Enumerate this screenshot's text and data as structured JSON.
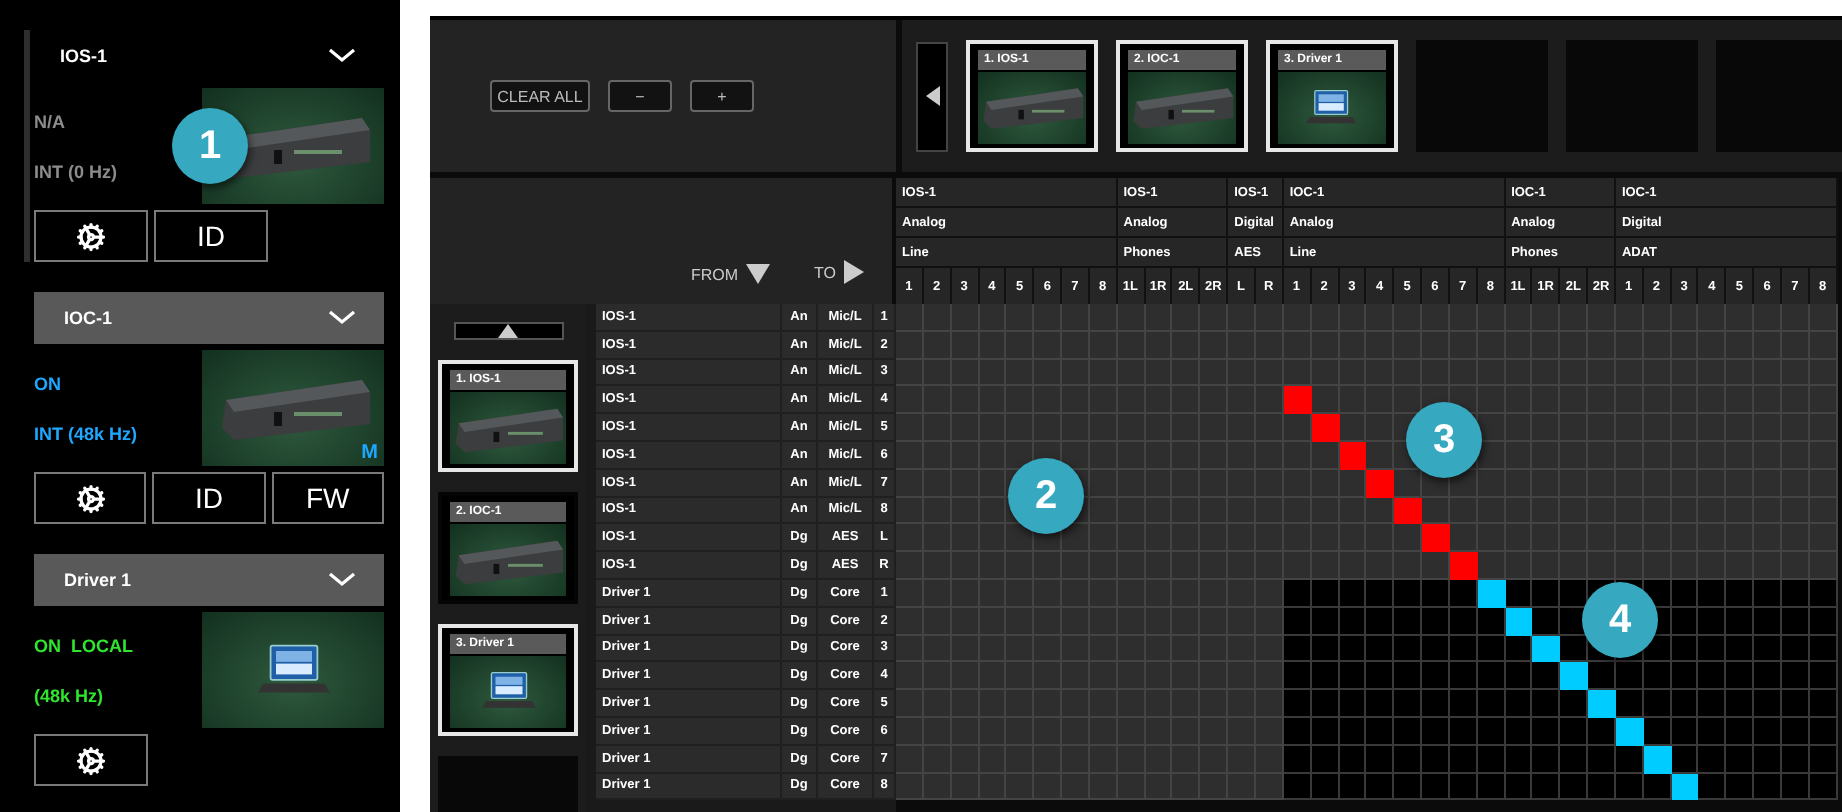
{
  "devices": [
    {
      "name": "IOS-1",
      "selected": true,
      "color": "#8c8c8c",
      "status": "N/A",
      "clock": "INT (0 Hz)",
      "kind": "hardware",
      "buttons": [
        {
          "kind": "gear"
        },
        {
          "kind": "text",
          "label": "ID"
        }
      ]
    },
    {
      "name": "IOC-1",
      "selected": false,
      "color": "#1ea7ff",
      "status": "ON",
      "clock": "INT (48k Hz)",
      "kind": "hardware",
      "badge": "M",
      "buttons": [
        {
          "kind": "gear"
        },
        {
          "kind": "text",
          "label": "ID"
        },
        {
          "kind": "text",
          "label": "FW"
        }
      ]
    },
    {
      "name": "Driver 1",
      "selected": false,
      "color": "#2ee62e",
      "status": "ON  LOCAL",
      "clock": "(48k Hz)",
      "kind": "driver",
      "buttons": [
        {
          "kind": "gear"
        }
      ]
    }
  ],
  "toolbar": {
    "buttons": [
      "CLEAR ALL",
      "−",
      "+"
    ]
  },
  "top_strip": [
    {
      "kind": "hardware",
      "label": "1. IOS-1",
      "selected": true
    },
    {
      "kind": "hardware",
      "label": "2. IOC-1",
      "selected": true
    },
    {
      "kind": "driver",
      "label": "3. Driver 1",
      "selected": true
    },
    {
      "kind": "empty"
    },
    {
      "kind": "empty"
    },
    {
      "kind": "empty"
    }
  ],
  "side_strip": [
    {
      "kind": "hardware",
      "label": "1. IOS-1",
      "selected": true
    },
    {
      "kind": "hardware",
      "label": "2. IOC-1",
      "selected": false
    },
    {
      "kind": "driver",
      "label": "3. Driver 1",
      "selected": true
    },
    {
      "kind": "empty"
    }
  ],
  "corner": {
    "from": "FROM",
    "to": "TO"
  },
  "column_groups": [
    {
      "device": "IOS-1",
      "type": "Analog",
      "sub": "Line",
      "dark": false,
      "channels": [
        "1",
        "2",
        "3",
        "4",
        "5",
        "6",
        "7",
        "8"
      ]
    },
    {
      "device": "IOS-1",
      "type": "Analog",
      "sub": "Phones",
      "dark": false,
      "channels": [
        "1L",
        "1R",
        "2L",
        "2R"
      ]
    },
    {
      "device": "IOS-1",
      "type": "Digital",
      "sub": "AES",
      "dark": false,
      "channels": [
        "L",
        "R"
      ]
    },
    {
      "device": "IOC-1",
      "type": "Analog",
      "sub": "Line",
      "dark": true,
      "channels": [
        "1",
        "2",
        "3",
        "4",
        "5",
        "6",
        "7",
        "8"
      ]
    },
    {
      "device": "IOC-1",
      "type": "Analog",
      "sub": "Phones",
      "dark": true,
      "channels": [
        "1L",
        "1R",
        "2L",
        "2R"
      ]
    },
    {
      "device": "IOC-1",
      "type": "Digital",
      "sub": "ADAT",
      "dark": true,
      "channels": [
        "1",
        "2",
        "3",
        "4",
        "5",
        "6",
        "7",
        "8"
      ]
    }
  ],
  "rows": [
    {
      "device": "IOS-1",
      "type": "An",
      "sub": "Mic/L",
      "channel": "1",
      "dark": false,
      "cells": [
        false,
        false,
        false,
        false,
        false,
        false,
        false,
        false,
        false,
        false,
        false,
        false,
        false,
        false,
        false,
        false,
        false,
        false,
        false,
        false,
        false,
        false,
        false,
        false,
        false,
        false,
        false,
        false,
        false,
        false,
        false,
        false,
        false,
        false
      ]
    },
    {
      "device": "IOS-1",
      "type": "An",
      "sub": "Mic/L",
      "channel": "2",
      "dark": false,
      "cells": [
        false,
        false,
        false,
        false,
        false,
        false,
        false,
        false,
        false,
        false,
        false,
        false,
        false,
        false,
        false,
        false,
        false,
        false,
        false,
        false,
        false,
        false,
        false,
        false,
        false,
        false,
        false,
        false,
        false,
        false,
        false,
        false,
        false,
        false
      ]
    },
    {
      "device": "IOS-1",
      "type": "An",
      "sub": "Mic/L",
      "channel": "3",
      "dark": false,
      "cells": [
        false,
        false,
        false,
        false,
        false,
        false,
        false,
        false,
        false,
        false,
        false,
        false,
        false,
        false,
        false,
        false,
        false,
        false,
        false,
        false,
        false,
        false,
        false,
        false,
        false,
        false,
        false,
        false,
        false,
        false,
        false,
        false,
        false,
        false
      ]
    },
    {
      "device": "IOS-1",
      "type": "An",
      "sub": "Mic/L",
      "channel": "4",
      "dark": false,
      "color": "#ff0000",
      "cells": [
        false,
        false,
        false,
        false,
        false,
        false,
        false,
        false,
        false,
        false,
        false,
        false,
        false,
        false,
        true,
        false,
        false,
        false,
        false,
        false,
        false,
        false,
        false,
        false,
        false,
        false,
        false,
        false,
        false,
        false,
        false,
        false,
        false,
        false
      ]
    },
    {
      "device": "IOS-1",
      "type": "An",
      "sub": "Mic/L",
      "channel": "5",
      "dark": false,
      "color": "#ff0000",
      "cells": [
        false,
        false,
        false,
        false,
        false,
        false,
        false,
        false,
        false,
        false,
        false,
        false,
        false,
        false,
        false,
        true,
        false,
        false,
        false,
        false,
        false,
        false,
        false,
        false,
        false,
        false,
        false,
        false,
        false,
        false,
        false,
        false,
        false,
        false
      ]
    },
    {
      "device": "IOS-1",
      "type": "An",
      "sub": "Mic/L",
      "channel": "6",
      "dark": false,
      "color": "#ff0000",
      "cells": [
        false,
        false,
        false,
        false,
        false,
        false,
        false,
        false,
        false,
        false,
        false,
        false,
        false,
        false,
        false,
        false,
        true,
        false,
        false,
        false,
        false,
        false,
        false,
        false,
        false,
        false,
        false,
        false,
        false,
        false,
        false,
        false,
        false,
        false
      ]
    },
    {
      "device": "IOS-1",
      "type": "An",
      "sub": "Mic/L",
      "channel": "7",
      "dark": false,
      "color": "#ff0000",
      "cells": [
        false,
        false,
        false,
        false,
        false,
        false,
        false,
        false,
        false,
        false,
        false,
        false,
        false,
        false,
        false,
        false,
        false,
        true,
        false,
        false,
        false,
        false,
        false,
        false,
        false,
        false,
        false,
        false,
        false,
        false,
        false,
        false,
        false,
        false
      ]
    },
    {
      "device": "IOS-1",
      "type": "An",
      "sub": "Mic/L",
      "channel": "8",
      "dark": false,
      "color": "#ff0000",
      "cells": [
        false,
        false,
        false,
        false,
        false,
        false,
        false,
        false,
        false,
        false,
        false,
        false,
        false,
        false,
        false,
        false,
        false,
        false,
        true,
        false,
        false,
        false,
        false,
        false,
        false,
        false,
        false,
        false,
        false,
        false,
        false,
        false,
        false,
        false
      ]
    },
    {
      "device": "IOS-1",
      "type": "Dg",
      "sub": "AES",
      "channel": "L",
      "dark": false,
      "color": "#ff0000",
      "cells": [
        false,
        false,
        false,
        false,
        false,
        false,
        false,
        false,
        false,
        false,
        false,
        false,
        false,
        false,
        false,
        false,
        false,
        false,
        false,
        true,
        false,
        false,
        false,
        false,
        false,
        false,
        false,
        false,
        false,
        false,
        false,
        false,
        false,
        false
      ]
    },
    {
      "device": "IOS-1",
      "type": "Dg",
      "sub": "AES",
      "channel": "R",
      "dark": false,
      "color": "#ff0000",
      "cells": [
        false,
        false,
        false,
        false,
        false,
        false,
        false,
        false,
        false,
        false,
        false,
        false,
        false,
        false,
        false,
        false,
        false,
        false,
        false,
        false,
        true,
        false,
        false,
        false,
        false,
        false,
        false,
        false,
        false,
        false,
        false,
        false,
        false,
        false
      ]
    },
    {
      "device": "Driver 1",
      "type": "Dg",
      "sub": "Core",
      "channel": "1",
      "dark": true,
      "color": "#00ccff",
      "cells": [
        false,
        false,
        false,
        false,
        false,
        false,
        false,
        false,
        false,
        false,
        false,
        false,
        false,
        false,
        false,
        false,
        false,
        false,
        false,
        false,
        false,
        true,
        false,
        false,
        false,
        false,
        false,
        false,
        false,
        false,
        false,
        false,
        false,
        false
      ]
    },
    {
      "device": "Driver 1",
      "type": "Dg",
      "sub": "Core",
      "channel": "2",
      "dark": true,
      "color": "#00ccff",
      "cells": [
        false,
        false,
        false,
        false,
        false,
        false,
        false,
        false,
        false,
        false,
        false,
        false,
        false,
        false,
        false,
        false,
        false,
        false,
        false,
        false,
        false,
        false,
        true,
        false,
        false,
        false,
        false,
        false,
        false,
        false,
        false,
        false,
        false,
        false
      ]
    },
    {
      "device": "Driver 1",
      "type": "Dg",
      "sub": "Core",
      "channel": "3",
      "dark": true,
      "color": "#00ccff",
      "cells": [
        false,
        false,
        false,
        false,
        false,
        false,
        false,
        false,
        false,
        false,
        false,
        false,
        false,
        false,
        false,
        false,
        false,
        false,
        false,
        false,
        false,
        false,
        false,
        true,
        false,
        false,
        false,
        false,
        false,
        false,
        false,
        false,
        false,
        false
      ]
    },
    {
      "device": "Driver 1",
      "type": "Dg",
      "sub": "Core",
      "channel": "4",
      "dark": true,
      "color": "#00ccff",
      "cells": [
        false,
        false,
        false,
        false,
        false,
        false,
        false,
        false,
        false,
        false,
        false,
        false,
        false,
        false,
        false,
        false,
        false,
        false,
        false,
        false,
        false,
        false,
        false,
        false,
        true,
        false,
        false,
        false,
        false,
        false,
        false,
        false,
        false,
        false
      ]
    },
    {
      "device": "Driver 1",
      "type": "Dg",
      "sub": "Core",
      "channel": "5",
      "dark": true,
      "color": "#00ccff",
      "cells": [
        false,
        false,
        false,
        false,
        false,
        false,
        false,
        false,
        false,
        false,
        false,
        false,
        false,
        false,
        false,
        false,
        false,
        false,
        false,
        false,
        false,
        false,
        false,
        false,
        false,
        true,
        false,
        false,
        false,
        false,
        false,
        false,
        false,
        false
      ]
    },
    {
      "device": "Driver 1",
      "type": "Dg",
      "sub": "Core",
      "channel": "6",
      "dark": true,
      "color": "#00ccff",
      "cells": [
        false,
        false,
        false,
        false,
        false,
        false,
        false,
        false,
        false,
        false,
        false,
        false,
        false,
        false,
        false,
        false,
        false,
        false,
        false,
        false,
        false,
        false,
        false,
        false,
        false,
        false,
        true,
        false,
        false,
        false,
        false,
        false,
        false,
        false
      ]
    },
    {
      "device": "Driver 1",
      "type": "Dg",
      "sub": "Core",
      "channel": "7",
      "dark": true,
      "color": "#00ccff",
      "cells": [
        false,
        false,
        false,
        false,
        false,
        false,
        false,
        false,
        false,
        false,
        false,
        false,
        false,
        false,
        false,
        false,
        false,
        false,
        false,
        false,
        false,
        false,
        false,
        false,
        false,
        false,
        false,
        true,
        false,
        false,
        false,
        false,
        false,
        false
      ]
    },
    {
      "device": "Driver 1",
      "type": "Dg",
      "sub": "Core",
      "channel": "8",
      "dark": true,
      "color": "#00ccff",
      "cells": [
        false,
        false,
        false,
        false,
        false,
        false,
        false,
        false,
        false,
        false,
        false,
        false,
        false,
        false,
        false,
        false,
        false,
        false,
        false,
        false,
        false,
        false,
        false,
        false,
        false,
        false,
        false,
        false,
        true,
        false,
        false,
        false,
        false,
        false
      ]
    }
  ],
  "callouts": [
    {
      "label": "1"
    },
    {
      "label": "2"
    },
    {
      "label": "3"
    },
    {
      "label": "4"
    }
  ]
}
